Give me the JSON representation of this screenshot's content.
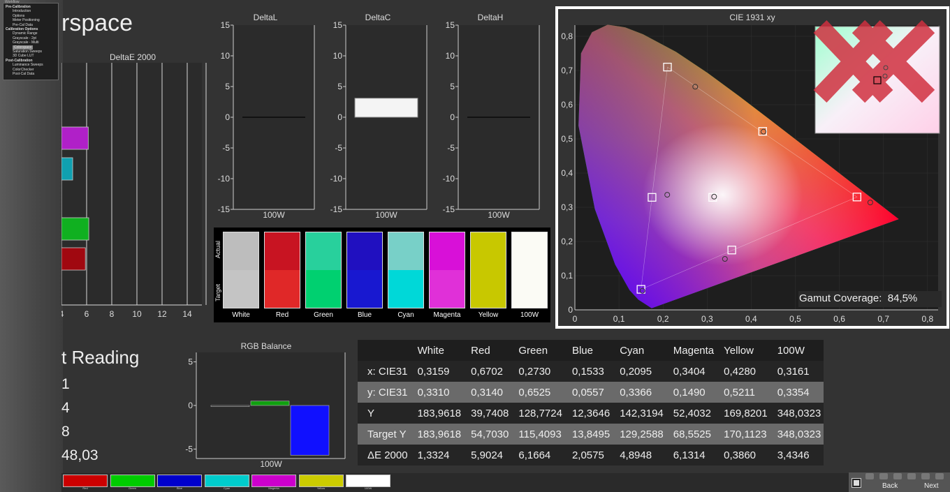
{
  "app": {
    "title_fragment": "rspace",
    "reading_fragment": "t Reading",
    "reading_values": [
      "1",
      "4",
      "8",
      "48,03"
    ]
  },
  "workflow": {
    "header": "Workflow",
    "sections": [
      {
        "label": "Pre-Calibration",
        "items": [
          "Introduction",
          "Options",
          "Meter Positioning",
          "Pre-Cal Data"
        ]
      },
      {
        "label": "Calibration Options",
        "items": [
          "Dynamic Range",
          "Grayscale - 2pt",
          "Grayscale - Multi",
          "Colorspace",
          "Saturation Sweeps",
          "3D Cube LUT"
        ]
      },
      {
        "label": "Post-Calibration",
        "items": [
          "Luminance Sweeps",
          "ColorChecker",
          "Post-Cal Data"
        ]
      }
    ],
    "selected": "Colorspace"
  },
  "deltaE_chart": {
    "title": "DeltaE 2000",
    "xticks": [
      "4",
      "6",
      "8",
      "10",
      "12",
      "14"
    ],
    "bars": [
      {
        "name": "Magenta",
        "value": 6.13,
        "color": "#b020c8"
      },
      {
        "name": "Cyan",
        "value": 4.89,
        "color": "#10a0b0"
      },
      {
        "name": "Green",
        "value": 6.17,
        "color": "#10b020"
      },
      {
        "name": "Red",
        "value": 5.9,
        "color": "#a00810"
      }
    ]
  },
  "delta_charts": [
    {
      "title": "DeltaL",
      "xlabel": "100W",
      "value": 0
    },
    {
      "title": "DeltaC",
      "xlabel": "100W",
      "value": 3.1
    },
    {
      "title": "DeltaH",
      "xlabel": "100W",
      "value": 0
    }
  ],
  "delta_yticks": [
    "15",
    "10",
    "5",
    "0",
    "-5",
    "-10",
    "-15"
  ],
  "swatches": {
    "actual_label": "Actual",
    "target_label": "Target",
    "items": [
      {
        "label": "White",
        "actual": "#bdbdbd",
        "target": "#c4c4c4"
      },
      {
        "label": "Red",
        "actual": "#c81422",
        "target": "#e02828"
      },
      {
        "label": "Green",
        "actual": "#28d09c",
        "target": "#00d070"
      },
      {
        "label": "Blue",
        "actual": "#2010c0",
        "target": "#1818d0"
      },
      {
        "label": "Cyan",
        "actual": "#78d0c8",
        "target": "#00d8d8"
      },
      {
        "label": "Magenta",
        "actual": "#d810d8",
        "target": "#e030d8"
      },
      {
        "label": "Yellow",
        "actual": "#c8c800",
        "target": "#c8c800"
      },
      {
        "label": "100W",
        "actual": "#fbfbf5",
        "target": "#fbfbf5"
      }
    ]
  },
  "rgb_balance": {
    "title": "RGB Balance",
    "xlabel": "100W",
    "yticks": [
      "5",
      "0",
      "-5"
    ],
    "values": [
      {
        "name": "Red",
        "value": 0.0,
        "color": "#111111"
      },
      {
        "name": "Green",
        "value": 0.5,
        "color": "#10a010"
      },
      {
        "name": "Blue",
        "value": -5.7,
        "color": "#1010ff"
      }
    ]
  },
  "cie": {
    "title": "CIE 1931 xy",
    "xticks": [
      "0",
      "0,1",
      "0,2",
      "0,3",
      "0,4",
      "0,5",
      "0,6",
      "0,7",
      "0,8"
    ],
    "yticks": [
      "0",
      "0,1",
      "0,2",
      "0,3",
      "0,4",
      "0,5",
      "0,6",
      "0,7",
      "0,8"
    ],
    "gamut_label": "Gamut Coverage:",
    "gamut_value": "84,5%",
    "targets": [
      {
        "name": "Red",
        "x": 0.64,
        "y": 0.33
      },
      {
        "name": "Green",
        "x": 0.21,
        "y": 0.71
      },
      {
        "name": "Blue",
        "x": 0.15,
        "y": 0.06
      },
      {
        "name": "White",
        "x": 0.3127,
        "y": 0.329
      },
      {
        "name": "Cyan",
        "x": 0.175,
        "y": 0.329
      },
      {
        "name": "Magenta",
        "x": 0.356,
        "y": 0.175
      },
      {
        "name": "Yellow",
        "x": 0.426,
        "y": 0.522
      }
    ],
    "measured": [
      {
        "name": "Red",
        "x": 0.6702,
        "y": 0.314
      },
      {
        "name": "Green",
        "x": 0.273,
        "y": 0.6525
      },
      {
        "name": "Blue",
        "x": 0.1533,
        "y": 0.0557
      },
      {
        "name": "White",
        "x": 0.3159,
        "y": 0.331
      },
      {
        "name": "Cyan",
        "x": 0.2095,
        "y": 0.3366
      },
      {
        "name": "Magenta",
        "x": 0.3404,
        "y": 0.149
      },
      {
        "name": "Yellow",
        "x": 0.428,
        "y": 0.5211
      }
    ]
  },
  "table": {
    "columns": [
      "",
      "White",
      "Red",
      "Green",
      "Blue",
      "Cyan",
      "Magenta",
      "Yellow",
      "100W"
    ],
    "rows": [
      [
        "x: CIE31",
        "0,3159",
        "0,6702",
        "0,2730",
        "0,1533",
        "0,2095",
        "0,3404",
        "0,4280",
        "0,3161"
      ],
      [
        "y: CIE31",
        "0,3310",
        "0,3140",
        "0,6525",
        "0,0557",
        "0,3366",
        "0,1490",
        "0,5211",
        "0,3354"
      ],
      [
        "Y",
        "183,9618",
        "39,7408",
        "128,7724",
        "12,3646",
        "142,3194",
        "52,4032",
        "169,8201",
        "348,0323"
      ],
      [
        "Target Y",
        "183,9618",
        "54,7030",
        "115,4093",
        "13,8495",
        "129,2588",
        "68,5525",
        "170,1123",
        "348,0323"
      ],
      [
        "ΔE 2000",
        "1,3324",
        "5,9024",
        "6,1664",
        "2,0575",
        "4,8948",
        "6,1314",
        "0,3860",
        "3,4346"
      ]
    ]
  },
  "bottom_swatches": [
    {
      "label": "Red",
      "color": "#cc0000"
    },
    {
      "label": "Green",
      "color": "#00cc00"
    },
    {
      "label": "Blue",
      "color": "#0000cc"
    },
    {
      "label": "Cyan",
      "color": "#00cccc"
    },
    {
      "label": "Magenta",
      "color": "#cc00cc"
    },
    {
      "label": "Yellow",
      "color": "#cccc00"
    },
    {
      "label": "100W",
      "color": "#ffffff"
    }
  ],
  "nav": {
    "back": "Back",
    "next": "Next"
  }
}
